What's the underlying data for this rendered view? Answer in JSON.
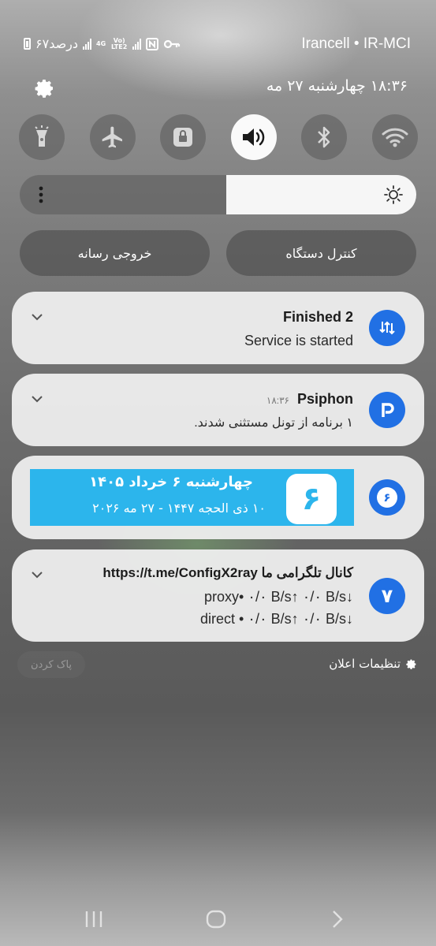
{
  "status_bar": {
    "battery_text": "۶۷درصد",
    "network_label": "4G",
    "volte_label": "Vo) LTE2",
    "carrier": "Irancell • IR-MCI"
  },
  "header": {
    "datetime": "۱۸:۳۶ چهارشنبه ۲۷ مه"
  },
  "quick_toggles": [
    {
      "icon": "flashlight-icon",
      "active": false
    },
    {
      "icon": "airplane-icon",
      "active": false
    },
    {
      "icon": "lock-rotation-icon",
      "active": false
    },
    {
      "icon": "sound-icon",
      "active": true
    },
    {
      "icon": "bluetooth-icon",
      "active": false
    },
    {
      "icon": "wifi-icon",
      "active": false
    }
  ],
  "brightness": {
    "level": 0.48
  },
  "media": {
    "output_label": "خروجی رسانه",
    "device_control_label": "کنترل دستگاه"
  },
  "notifications": [
    {
      "title": "Finished 2",
      "body": "Service is started"
    },
    {
      "title": "Psiphon",
      "time": "۱۸:۳۶",
      "body": "۱ برنامه از تونل مستثنی شدند."
    },
    {
      "icon_text": "۶",
      "line1": "چهارشنبه ۶ خرداد ۱۴۰۵",
      "line2": "۱۰ ذی الحجه ۱۴۴۷ - ۲۷ مه ۲۰۲۶"
    },
    {
      "icon_text": "۷",
      "title": "کانال تلگرامی ما https://t.me/ConfigX2ray",
      "line1": "proxy• ۰/۰ B/s↑ ۰/۰ B/s↓",
      "line2": "direct • ۰/۰ B/s↑ ۰/۰ B/s↓"
    }
  ],
  "footer": {
    "clear_label": "پاک کردن",
    "settings_label": "تنظیمات اعلان"
  },
  "colors": {
    "accent_blue": "#2170e4",
    "banner_blue": "#2cb5ec"
  }
}
